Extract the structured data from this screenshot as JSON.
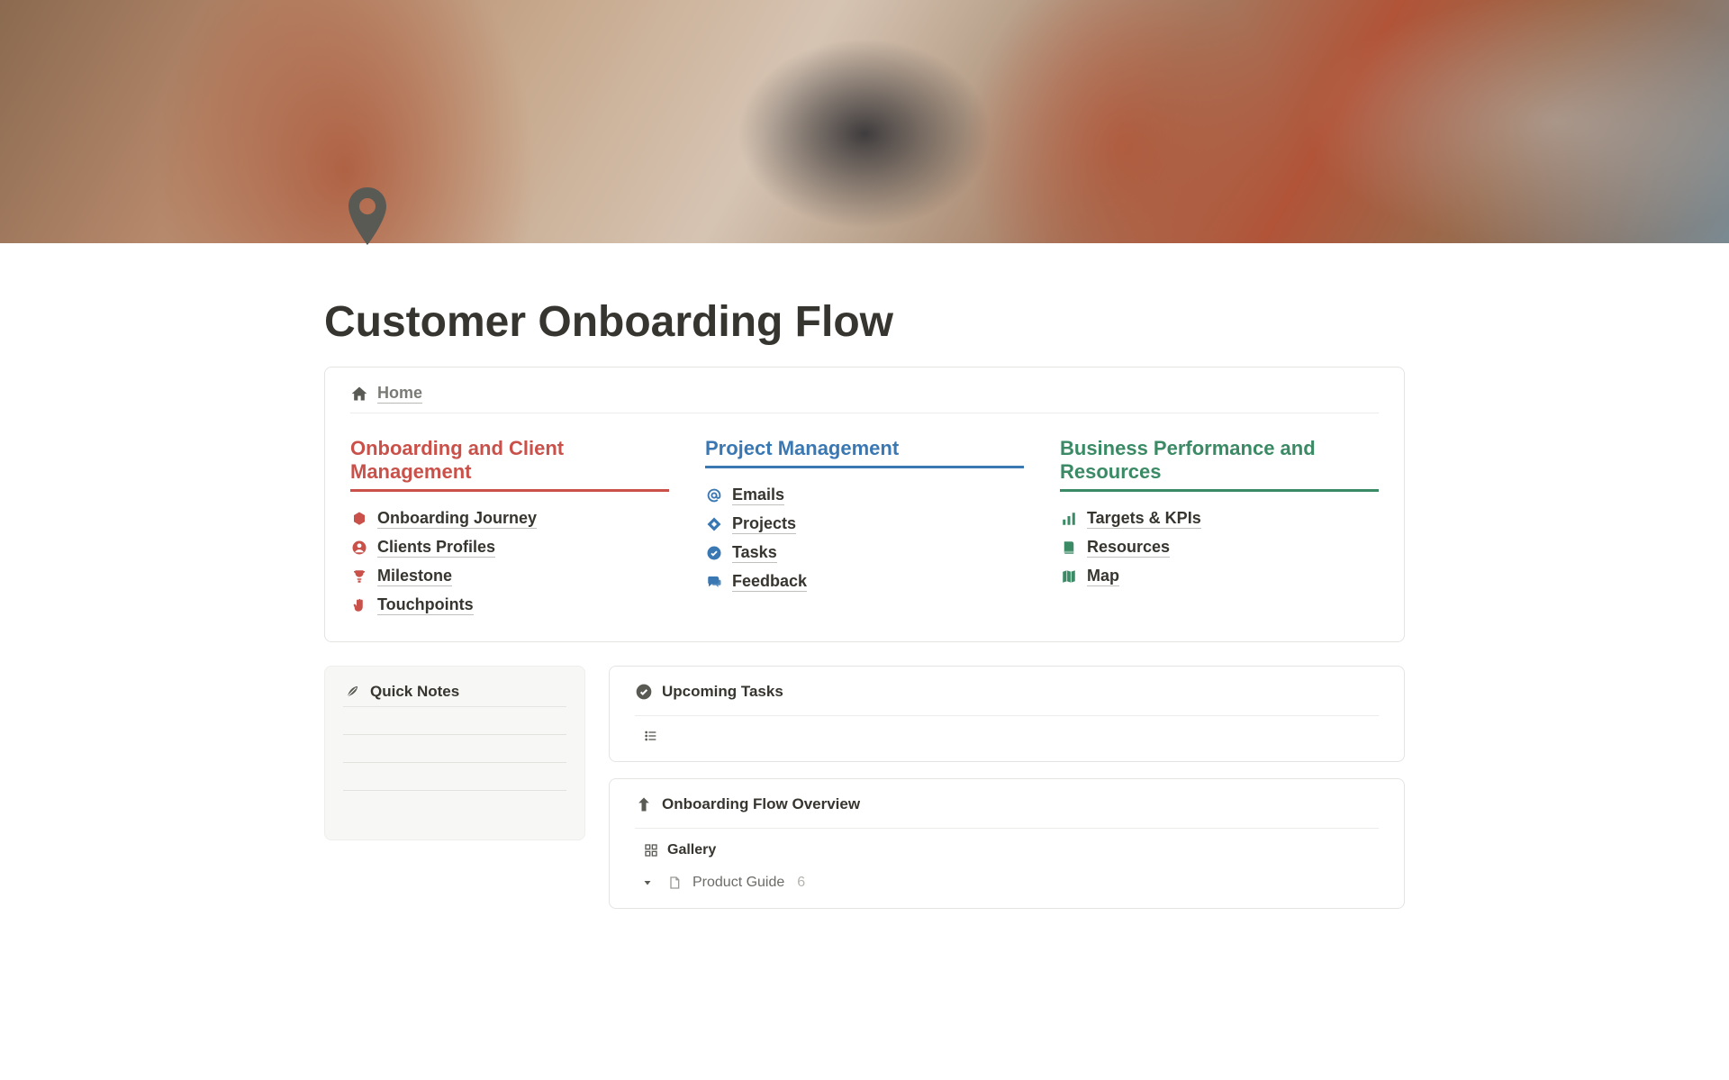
{
  "page": {
    "title": "Customer Onboarding Flow",
    "home_label": "Home"
  },
  "sections": {
    "onboarding": {
      "title": "Onboarding and Client Management",
      "items": [
        {
          "label": "Onboarding Journey"
        },
        {
          "label": "Clients Profiles"
        },
        {
          "label": "Milestone"
        },
        {
          "label": "Touchpoints"
        }
      ]
    },
    "project": {
      "title": "Project Management",
      "items": [
        {
          "label": "Emails"
        },
        {
          "label": "Projects"
        },
        {
          "label": "Tasks"
        },
        {
          "label": "Feedback"
        }
      ]
    },
    "business": {
      "title": "Business Performance and Resources",
      "items": [
        {
          "label": "Targets & KPIs"
        },
        {
          "label": "Resources"
        },
        {
          "label": "Map"
        }
      ]
    }
  },
  "quick_notes": {
    "title": "Quick Notes"
  },
  "upcoming_tasks": {
    "title": "Upcoming Tasks"
  },
  "overview": {
    "title": "Onboarding Flow Overview",
    "view_label": "Gallery",
    "group_label": "Product Guide",
    "group_count": "6"
  }
}
